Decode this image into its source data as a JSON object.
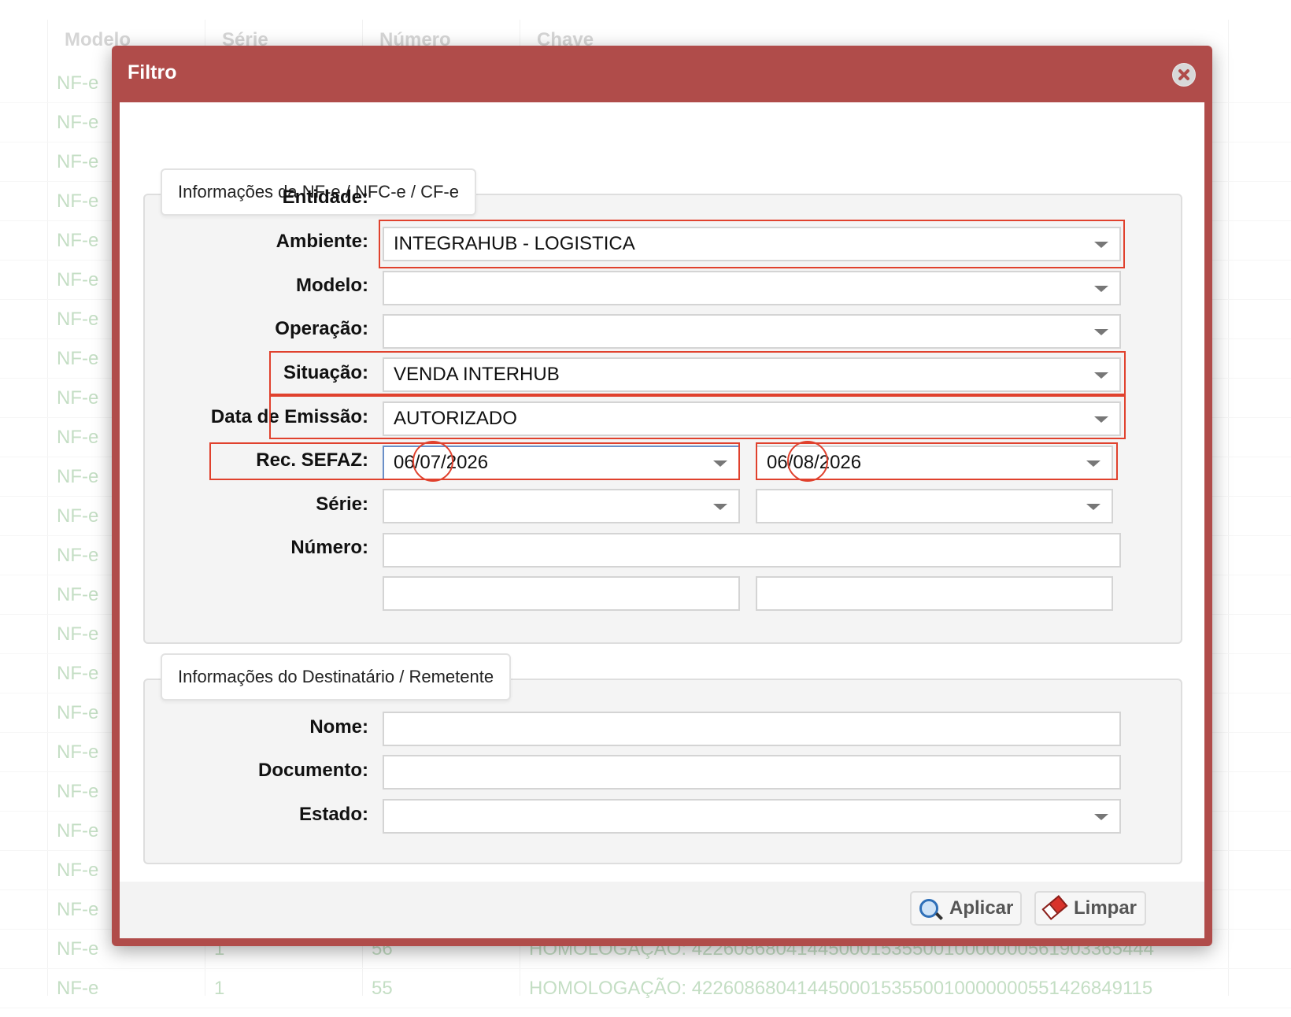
{
  "background_table": {
    "headers": [
      "Modelo",
      "Série",
      "Número",
      "Chave"
    ],
    "rows": [
      {
        "modelo": "NF-e",
        "serie": "",
        "numero": "",
        "chave": ""
      },
      {
        "modelo": "NF-e",
        "serie": "",
        "numero": "",
        "chave": ""
      },
      {
        "modelo": "NF-e",
        "serie": "",
        "numero": "",
        "chave": ""
      },
      {
        "modelo": "NF-e",
        "serie": "",
        "numero": "",
        "chave": ""
      },
      {
        "modelo": "NF-e",
        "serie": "",
        "numero": "",
        "chave": ""
      },
      {
        "modelo": "NF-e",
        "serie": "",
        "numero": "",
        "chave": ""
      },
      {
        "modelo": "NF-e",
        "serie": "",
        "numero": "",
        "chave": ""
      },
      {
        "modelo": "NF-e",
        "serie": "",
        "numero": "",
        "chave": ""
      },
      {
        "modelo": "NF-e",
        "serie": "",
        "numero": "",
        "chave": ""
      },
      {
        "modelo": "NF-e",
        "serie": "",
        "numero": "",
        "chave": ""
      },
      {
        "modelo": "NF-e",
        "serie": "",
        "numero": "",
        "chave": ""
      },
      {
        "modelo": "NF-e",
        "serie": "",
        "numero": "",
        "chave": ""
      },
      {
        "modelo": "NF-e",
        "serie": "",
        "numero": "",
        "chave": ""
      },
      {
        "modelo": "NF-e",
        "serie": "",
        "numero": "",
        "chave": ""
      },
      {
        "modelo": "NF-e",
        "serie": "",
        "numero": "",
        "chave": ""
      },
      {
        "modelo": "NF-e",
        "serie": "",
        "numero": "",
        "chave": ""
      },
      {
        "modelo": "NF-e",
        "serie": "",
        "numero": "",
        "chave": ""
      },
      {
        "modelo": "NF-e",
        "serie": "",
        "numero": "",
        "chave": ""
      },
      {
        "modelo": "NF-e",
        "serie": "",
        "numero": "",
        "chave": ""
      },
      {
        "modelo": "NF-e",
        "serie": "",
        "numero": "",
        "chave": ""
      },
      {
        "modelo": "NF-e",
        "serie": "",
        "numero": "",
        "chave": ""
      },
      {
        "modelo": "NF-e",
        "serie": "",
        "numero": "",
        "chave": ""
      },
      {
        "modelo": "NF-e",
        "serie": "1",
        "numero": "56",
        "chave": "HOMOLOGAÇÃO: 42260868041445000153550010000000561903365444"
      },
      {
        "modelo": "NF-e",
        "serie": "1",
        "numero": "55",
        "chave": "HOMOLOGAÇÃO: 42260868041445000153550010000000551426849115"
      }
    ]
  },
  "dialog": {
    "title": "Filtro",
    "section1": {
      "legend": "Informações da NF-e / NFC-e / CF-e",
      "entidade": {
        "label": "Entidade:",
        "value": "INTEGRAHUB - LOGISTICA"
      },
      "ambiente": {
        "label": "Ambiente:",
        "value": ""
      },
      "modelo": {
        "label": "Modelo:",
        "value": ""
      },
      "operacao": {
        "label": "Operação:",
        "value": "VENDA INTERHUB"
      },
      "situacao": {
        "label": "Situação:",
        "value": "AUTORIZADO"
      },
      "data_emissao": {
        "label": "Data de Emissão:",
        "from": "06/07/2026",
        "to": "06/08/2026"
      },
      "rec_sefaz": {
        "label": "Rec. SEFAZ:",
        "from": "",
        "to": ""
      },
      "serie": {
        "label": "Série:",
        "value": ""
      },
      "numero": {
        "label": "Número:",
        "from": "",
        "to": ""
      }
    },
    "section2": {
      "legend": "Informações do Destinatário / Remetente",
      "nome": {
        "label": "Nome:",
        "value": ""
      },
      "documento": {
        "label": "Documento:",
        "value": ""
      },
      "estado": {
        "label": "Estado:",
        "value": ""
      }
    },
    "footer": {
      "apply_label": "Aplicar",
      "clear_label": "Limpar"
    }
  },
  "colors": {
    "dialog_frame": "#b04c4a",
    "highlight": "#e0412d",
    "table_text": "#5aa35a"
  }
}
